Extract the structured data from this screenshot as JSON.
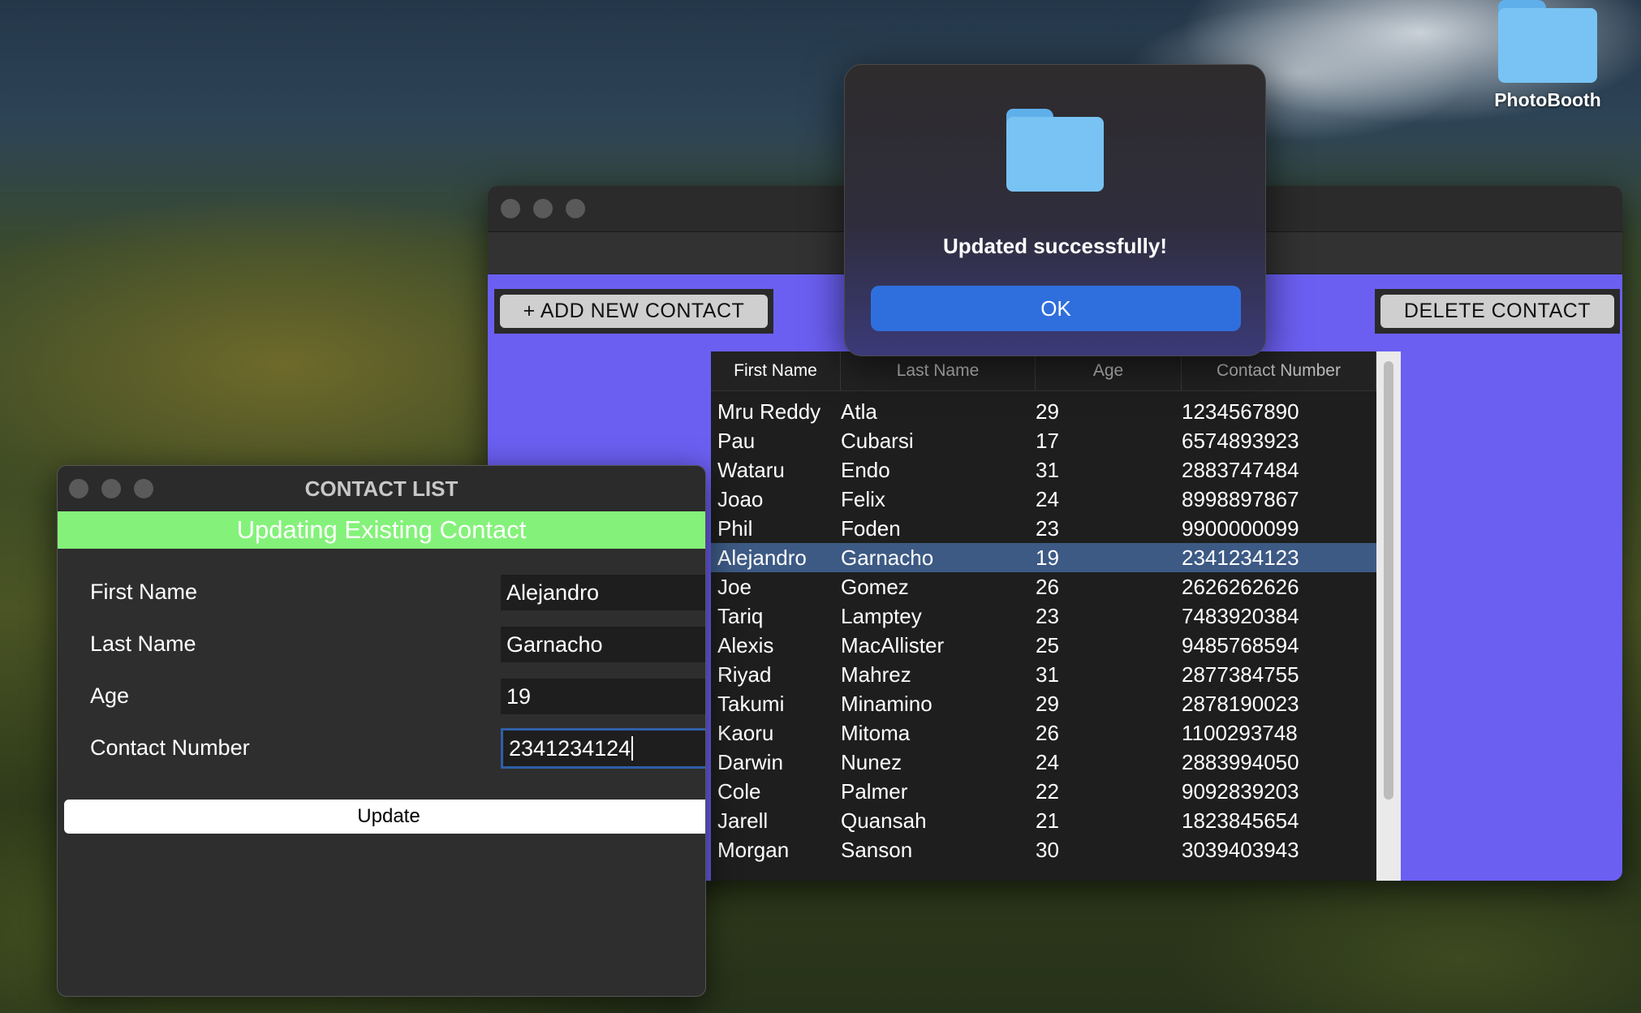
{
  "desktop": {
    "icons": [
      {
        "label": "PhotoBooth",
        "icon": "folder-icon"
      }
    ]
  },
  "main_window": {
    "add_button_label": "+ ADD NEW CONTACT",
    "delete_button_label": "DELETE CONTACT",
    "table": {
      "columns": [
        "First Name",
        "Last Name",
        "Age",
        "Contact Number"
      ],
      "rows": [
        [
          "Mru Reddy",
          "Atla",
          "29",
          "1234567890"
        ],
        [
          "Pau",
          "Cubarsi",
          "17",
          "6574893923"
        ],
        [
          "Wataru",
          "Endo",
          "31",
          "2883747484"
        ],
        [
          "Joao",
          "Felix",
          "24",
          "8998897867"
        ],
        [
          "Phil",
          "Foden",
          "23",
          "9900000099"
        ],
        [
          "Alejandro",
          "Garnacho",
          "19",
          "2341234123"
        ],
        [
          "Joe",
          "Gomez",
          "26",
          "2626262626"
        ],
        [
          "Tariq",
          "Lamptey",
          "23",
          "7483920384"
        ],
        [
          "Alexis",
          "MacAllister",
          "25",
          "9485768594"
        ],
        [
          "Riyad",
          "Mahrez",
          "31",
          "2877384755"
        ],
        [
          "Takumi",
          "Minamino",
          "29",
          "2878190023"
        ],
        [
          "Kaoru",
          "Mitoma",
          "26",
          "1100293748"
        ],
        [
          "Darwin",
          "Nunez",
          "24",
          "2883994050"
        ],
        [
          "Cole",
          "Palmer",
          "22",
          "9092839203"
        ],
        [
          "Jarell",
          "Quansah",
          "21",
          "1823845654"
        ],
        [
          "Morgan",
          "Sanson",
          "30",
          "3039403943"
        ]
      ],
      "selected_row": 5
    }
  },
  "alert": {
    "icon": "folder-icon",
    "message": "Updated successfully!",
    "ok_label": "OK"
  },
  "form_window": {
    "title": "CONTACT LIST",
    "banner": "Updating Existing Contact",
    "fields": [
      {
        "label": "First Name",
        "value": "Alejandro"
      },
      {
        "label": "Last Name",
        "value": "Garnacho"
      },
      {
        "label": "Age",
        "value": "19"
      },
      {
        "label": "Contact Number",
        "value": "2341234124"
      }
    ],
    "update_label": "Update"
  },
  "colors": {
    "window_accent": "#6b5ff2",
    "banner": "#84f27a",
    "ok_button": "#2f6fdd",
    "selected_row": "#3d5a85",
    "folder": "#7cc6f5"
  }
}
